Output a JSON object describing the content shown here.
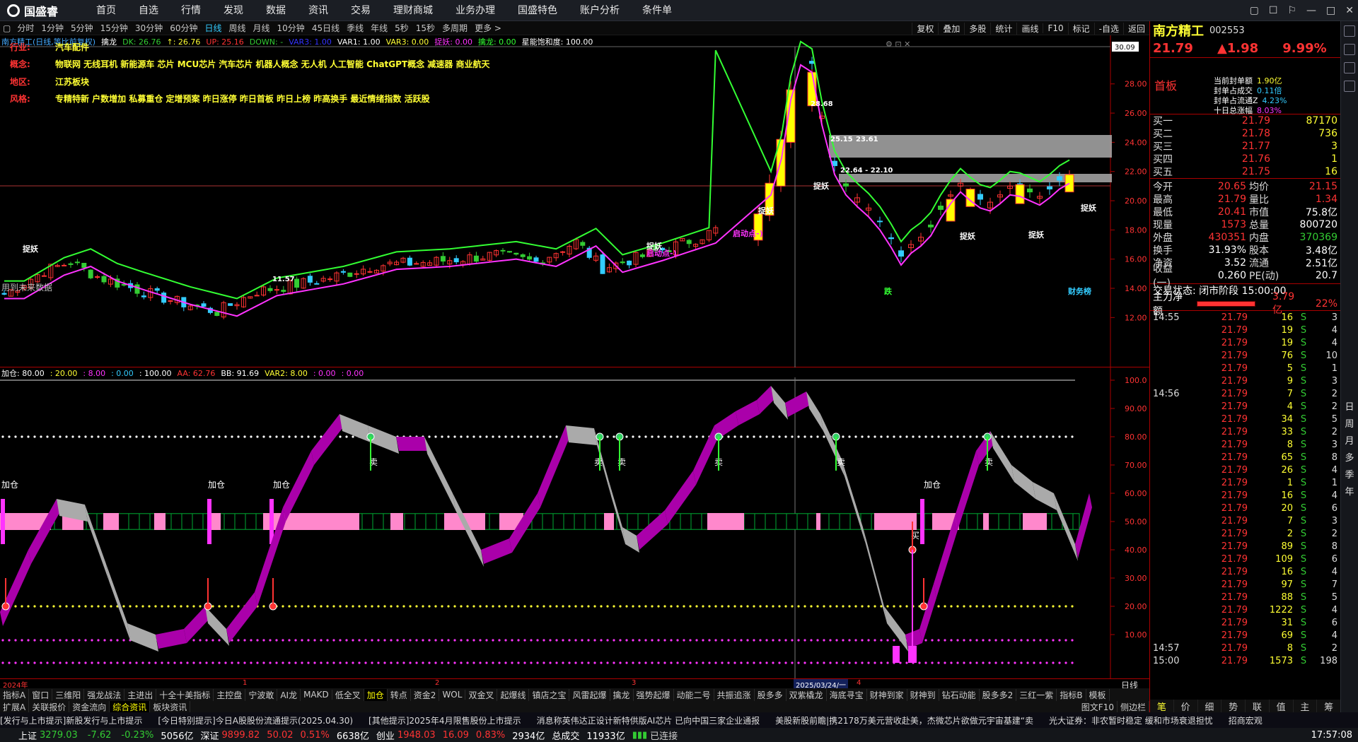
{
  "app": {
    "logo_text": "国盛睿",
    "nav": [
      "首页",
      "自选",
      "行情",
      "发现",
      "数据",
      "资讯",
      "交易",
      "理财商城",
      "业务办理",
      "国盛特色",
      "账户分析",
      "条件单"
    ],
    "window_controls": [
      "▢",
      "☐",
      "⚐",
      "—",
      "□",
      "✕"
    ]
  },
  "periods": [
    "分时",
    "1分钟",
    "5分钟",
    "15分钟",
    "30分钟",
    "60分钟",
    "日线",
    "周线",
    "月线",
    "10分钟",
    "45日线",
    "季线",
    "年线",
    "5秒",
    "15秒",
    "多周期",
    "更多 >"
  ],
  "active_period": "日线",
  "toolbar_right": [
    "复权",
    "叠加",
    "多股",
    "统计",
    "画线",
    "F10",
    "标记",
    "-自选",
    "返回"
  ],
  "main_legend": [
    {
      "text": "南方精工(日线,等比前复权)",
      "color": "#4af"
    },
    {
      "text": "擒龙",
      "color": "#fff"
    },
    {
      "text": "DK: 26.76",
      "color": "#3c3"
    },
    {
      "text": "↑: 26.76",
      "color": "#ff3"
    },
    {
      "text": "UP: 25.16",
      "color": "#f33"
    },
    {
      "text": "DOWN: -",
      "color": "#3c3"
    },
    {
      "text": "VAR3: 1.00",
      "color": "#33f"
    },
    {
      "text": "VAR1: 1.00",
      "color": "#fff"
    },
    {
      "text": "VAR3: 0.00",
      "color": "#ff3"
    },
    {
      "text": "捉妖: 0.00",
      "color": "#f3f"
    },
    {
      "text": "擒龙: 0.00",
      "color": "#3f3"
    },
    {
      "text": "星能饱和度: 100.00",
      "color": "#fff"
    }
  ],
  "stock_info": [
    {
      "key": "行业:",
      "value": "汽车配件",
      "key_color": "red"
    },
    {
      "key": "概念:",
      "value": "物联网 无线耳机 新能源车 芯片 MCU芯片 汽车芯片 机器人概念 无人机 人工智能 ChatGPT概念 减速器 商业航天",
      "key_color": "red"
    },
    {
      "key": "地区:",
      "value": "江苏板块",
      "key_color": "red"
    },
    {
      "key": "风格:",
      "value": "专精特新 户数增加 私募重仓 定增预案 昨日涨停 昨日首板 昨日上榜 昨高换手 最近情绪指数 活跃股",
      "key_color": "red"
    }
  ],
  "main_annotations": {
    "no_future": "用到未来数据",
    "zhuoyao": "捉妖",
    "qidong": "启动点-)",
    "die": "跌",
    "cai": "财务榜",
    "hi": "28.68",
    "lvl1": "25.15",
    "lvl2": "23.61",
    "lvl3": "22.64 - 22.10",
    "lo": "11.57",
    "price_tag": "30.09"
  },
  "price_axis": [
    "28.00",
    "26.00",
    "24.00",
    "22.00",
    "20.00",
    "18.00",
    "16.00",
    "14.00",
    "12.00"
  ],
  "ind_legend": [
    {
      "text": "加仓: 80.00",
      "color": "#fff"
    },
    {
      "text": ": 20.00",
      "color": "#ff3"
    },
    {
      "text": ": 8.00",
      "color": "#f3f"
    },
    {
      "text": ": 0.00",
      "color": "#3cf"
    },
    {
      "text": ": 100.00",
      "color": "#fff"
    },
    {
      "text": "AA: 62.76",
      "color": "#f33"
    },
    {
      "text": "BB: 91.69",
      "color": "#fff"
    },
    {
      "text": "VAR2: 8.00",
      "color": "#ff3"
    },
    {
      "text": ": 0.00",
      "color": "#f3f"
    },
    {
      "text": ": 0.00",
      "color": "#f3f"
    }
  ],
  "ind_axis": [
    "100.0",
    "90.00",
    "80.00",
    "70.00",
    "60.00",
    "50.00",
    "40.00",
    "30.00",
    "20.00",
    "10.00"
  ],
  "ind_labels": {
    "jiacang": "加仓",
    "mai": "卖",
    "mai2": "买"
  },
  "time_axis": {
    "start": "2024年",
    "m1": "1",
    "m2": "2",
    "m3": "3",
    "cursor": "2025/03/24/一",
    "m4": "4",
    "right": "日线"
  },
  "indicator_tabs": [
    "指标A",
    "窗口",
    "三维阳",
    "强龙战法",
    "主进出",
    "十全十美指标",
    "主控盘",
    "宁波敢",
    "AI龙",
    "MAKD",
    "低全叉",
    "加仓",
    "转点",
    "资金2",
    "WOL",
    "双金叉",
    "起爆线",
    "镇店之宝",
    "风雷起爆",
    "擒龙",
    "强势起爆",
    "动能二号",
    "共振追涨",
    "股多多",
    "双紫橇龙",
    "海底寻宝",
    "财神到家",
    "财神到",
    "钻石动能",
    "股多多2",
    "三红一紫",
    "指标B",
    "模板"
  ],
  "active_indicator": "加仓",
  "indicator_tabs2": [
    "扩展A",
    "关联报价",
    "资金流向",
    "综合资讯",
    "板块资讯"
  ],
  "active_tab2": "综合资讯",
  "right_links": [
    "图文F10",
    "侧边栏"
  ],
  "news": [
    "[发行与上市提示]新股发行与上市提示",
    "[今日特别提示]今日A股股份流通提示(2025.04.30)",
    "[其他提示]2025年4月限售股份上市提示",
    "消息称英伟达正设计新特供版AI芯片 已向中国三家企业通报",
    "美股新股前瞻|携2178万美元营收赴美，杰微芯片欲做元宇宙基建“卖",
    "光大证券：非农暂时稳定 缓和市场衰退担忧",
    "招商宏观"
  ],
  "statusbar": {
    "sh": "上证",
    "sh_val": "3279.03",
    "sh_chg": "-7.62",
    "sh_pct": "-0.23%",
    "sh_amt": "5056亿",
    "sz": "深证",
    "sz_val": "9899.82",
    "sz_chg": "50.02",
    "sz_pct": "0.51%",
    "sz_amt": "6638亿",
    "cy": "创业",
    "cy_val": "1948.03",
    "cy_chg": "16.09",
    "cy_pct": "0.83%",
    "cy_amt": "2934亿",
    "total_lbl": "总成交",
    "total": "11933亿",
    "conn": "已连接",
    "clock": "17:57:08"
  },
  "quote": {
    "name": "南方精工",
    "code": "002553",
    "price": "21.79",
    "change": "▲1.98",
    "pct": "9.99%",
    "tag": "首板",
    "seal": [
      {
        "k": "当前封单额",
        "v": "1.90亿",
        "c": "#ff3"
      },
      {
        "k": "封单占成交",
        "v": "0.11倍",
        "c": "#3cf"
      },
      {
        "k": "封单占流通Z",
        "v": "4.23%",
        "c": "#3cf"
      },
      {
        "k": "十日总涨幅",
        "v": "8.03%",
        "c": "#f3f"
      }
    ],
    "bids": [
      {
        "lbl": "买一",
        "price": "21.79",
        "vol": "87170"
      },
      {
        "lbl": "买二",
        "price": "21.78",
        "vol": "736"
      },
      {
        "lbl": "买三",
        "price": "21.77",
        "vol": "3"
      },
      {
        "lbl": "买四",
        "price": "21.76",
        "vol": "1"
      },
      {
        "lbl": "买五",
        "price": "21.75",
        "vol": "16"
      }
    ],
    "grid": [
      {
        "k": "今开",
        "v": "20.65",
        "vc": "",
        "k2": "均价",
        "v2": "21.15",
        "v2c": ""
      },
      {
        "k": "最高",
        "v": "21.79",
        "vc": "",
        "k2": "量比",
        "v2": "1.34",
        "v2c": ""
      },
      {
        "k": "最低",
        "v": "20.41",
        "vc": "",
        "k2": "市值",
        "v2": "75.8亿",
        "v2c": "wt"
      },
      {
        "k": "现量",
        "v": "1573",
        "vc": "",
        "k2": "总量",
        "v2": "800720",
        "v2c": "wt"
      },
      {
        "k": "外盘",
        "v": "430351",
        "vc": "",
        "k2": "内盘",
        "v2": "370369",
        "v2c": "gr"
      },
      {
        "k": "换手",
        "v": "31.93%",
        "vc": "wt",
        "k2": "股本",
        "v2": "3.48亿",
        "v2c": "wt"
      },
      {
        "k": "净资",
        "v": "3.52",
        "vc": "wt",
        "k2": "流通",
        "v2": "2.51亿",
        "v2c": "wt"
      },
      {
        "k": "收益(一)",
        "v": "0.260",
        "vc": "wt",
        "k2": "PE(动)",
        "v2": "20.7",
        "v2c": "wt"
      }
    ],
    "trade_state": "交易状态: 闭市阶段 15:00:00",
    "netflow_lbl": "主力净额",
    "netflow_amt": "3.79亿",
    "netflow_pct": "22%",
    "ticks": [
      {
        "t": "14:55",
        "p": "21.79",
        "q": "16",
        "s": "S",
        "n": "3"
      },
      {
        "t": "",
        "p": "21.79",
        "q": "19",
        "s": "S",
        "n": "4"
      },
      {
        "t": "",
        "p": "21.79",
        "q": "19",
        "s": "S",
        "n": "4"
      },
      {
        "t": "",
        "p": "21.79",
        "q": "76",
        "s": "S",
        "n": "10"
      },
      {
        "t": "",
        "p": "21.79",
        "q": "5",
        "s": "S",
        "n": "1"
      },
      {
        "t": "",
        "p": "21.79",
        "q": "9",
        "s": "S",
        "n": "3"
      },
      {
        "t": "14:56",
        "p": "21.79",
        "q": "7",
        "s": "S",
        "n": "2"
      },
      {
        "t": "",
        "p": "21.79",
        "q": "4",
        "s": "S",
        "n": "2"
      },
      {
        "t": "",
        "p": "21.79",
        "q": "34",
        "s": "S",
        "n": "5"
      },
      {
        "t": "",
        "p": "21.79",
        "q": "33",
        "s": "S",
        "n": "2"
      },
      {
        "t": "",
        "p": "21.79",
        "q": "8",
        "s": "S",
        "n": "3"
      },
      {
        "t": "",
        "p": "21.79",
        "q": "65",
        "s": "S",
        "n": "8"
      },
      {
        "t": "",
        "p": "21.79",
        "q": "26",
        "s": "S",
        "n": "4"
      },
      {
        "t": "",
        "p": "21.79",
        "q": "1",
        "s": "S",
        "n": "1"
      },
      {
        "t": "",
        "p": "21.79",
        "q": "16",
        "s": "S",
        "n": "4"
      },
      {
        "t": "",
        "p": "21.79",
        "q": "20",
        "s": "S",
        "n": "6"
      },
      {
        "t": "",
        "p": "21.79",
        "q": "7",
        "s": "S",
        "n": "3"
      },
      {
        "t": "",
        "p": "21.79",
        "q": "2",
        "s": "S",
        "n": "2"
      },
      {
        "t": "",
        "p": "21.79",
        "q": "89",
        "s": "S",
        "n": "8"
      },
      {
        "t": "",
        "p": "21.79",
        "q": "109",
        "s": "S",
        "n": "6"
      },
      {
        "t": "",
        "p": "21.79",
        "q": "16",
        "s": "S",
        "n": "4"
      },
      {
        "t": "",
        "p": "21.79",
        "q": "97",
        "s": "S",
        "n": "7"
      },
      {
        "t": "",
        "p": "21.79",
        "q": "88",
        "s": "S",
        "n": "5"
      },
      {
        "t": "",
        "p": "21.79",
        "q": "1222",
        "s": "S",
        "n": "4"
      },
      {
        "t": "",
        "p": "21.79",
        "q": "31",
        "s": "S",
        "n": "6"
      },
      {
        "t": "",
        "p": "21.79",
        "q": "69",
        "s": "S",
        "n": "4"
      },
      {
        "t": "14:57",
        "p": "21.79",
        "q": "8",
        "s": "S",
        "n": "2"
      },
      {
        "t": "15:00",
        "p": "21.79",
        "q": "1573",
        "s": "S",
        "n": "198"
      }
    ],
    "tabs": [
      "笔",
      "价",
      "细",
      "势",
      "联",
      "值",
      "主",
      "筹"
    ]
  },
  "side_strip": [
    "日",
    "周",
    "月",
    "多",
    "季",
    "年"
  ],
  "colors": {
    "up": "#ff3333",
    "down": "#33cc33",
    "accent_yellow": "#ffff33",
    "magenta": "#ff33ff"
  }
}
